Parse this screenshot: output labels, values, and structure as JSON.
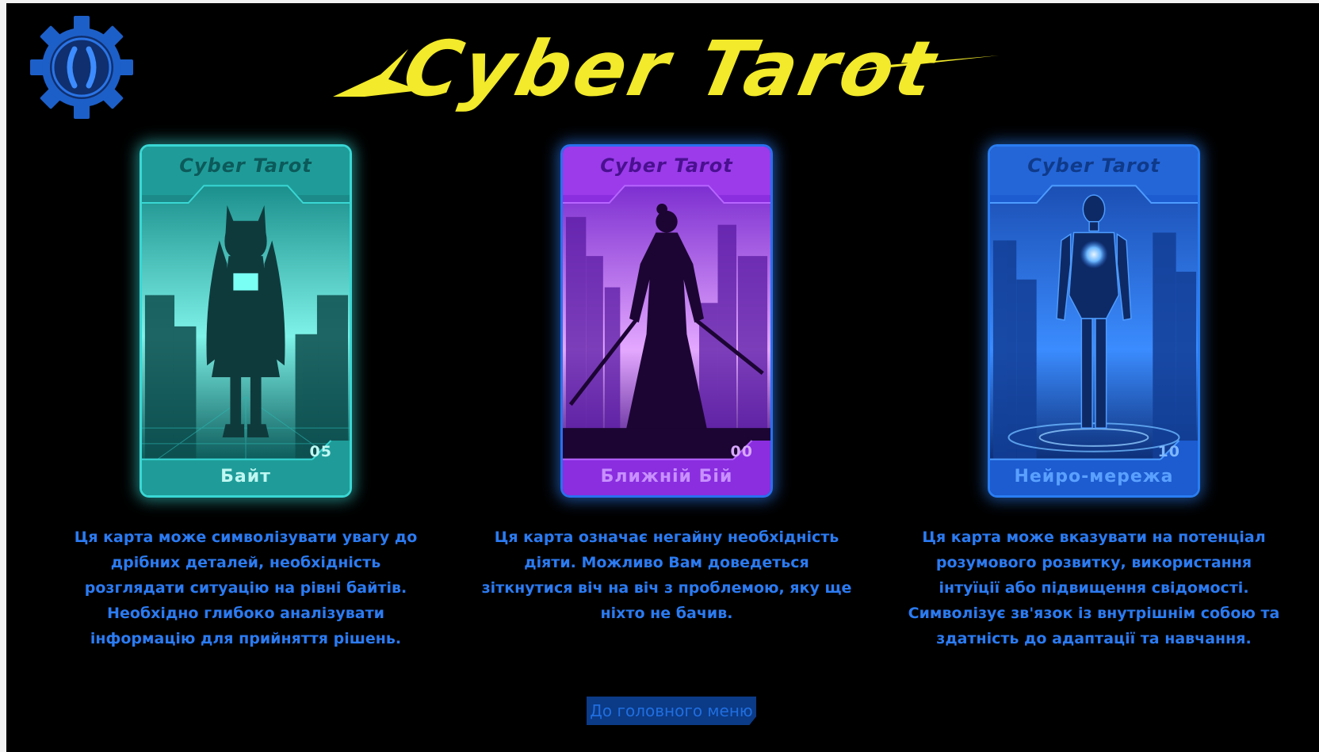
{
  "app": {
    "title": "Cyber Tarot",
    "logo_icon": "gear-bracket-icon"
  },
  "colors": {
    "title_yellow": "#f2ea2a",
    "text_blue": "#2b7bf2",
    "button_bg": "#0b3a86",
    "card1": "#39d7d4",
    "card2": "#a13ef0",
    "card3": "#2a7df2"
  },
  "cards": [
    {
      "brand": "Cyber Tarot",
      "number": "05",
      "name": "Байт",
      "description": "Ця карта може символізувати увагу до дрібних деталей, необхідність розглядати ситуацію на рівні байтів. Необхідно глибоко аналізувати інформацію для прийняття рішень."
    },
    {
      "brand": "Cyber Tarot",
      "number": "00",
      "name": "Ближній Бій",
      "description": "Ця карта означає негайну необхідність діяти. Можливо Вам доведеться зіткнутися віч на віч з проблемою, яку ще ніхто не бачив."
    },
    {
      "brand": "Cyber Tarot",
      "number": "10",
      "name": "Нейро-мережа",
      "description": "Ця карта може вказувати на потенціал розумового розвитку, використання інтуїції або підвищення свідомості. Символізує зв'язок із внутрішнім собою та здатність до адаптації та навчання."
    }
  ],
  "menu_button": {
    "label": "До головного меню"
  }
}
